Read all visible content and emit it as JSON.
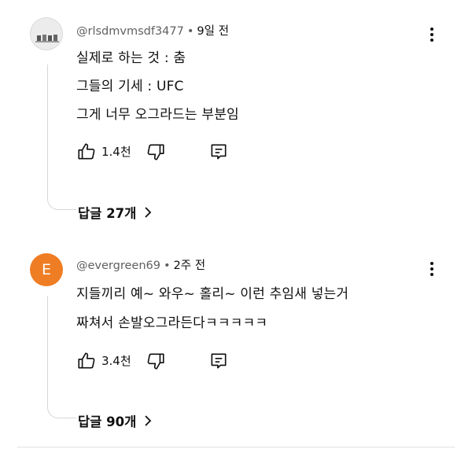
{
  "comments": [
    {
      "handle": "@rlsdmvmsdf3477",
      "time": "9일 전",
      "lines": [
        "실제로 하는 것 : 춤",
        "그들의 기세 : UFC",
        "그게 너무 오그라드는 부분임"
      ],
      "likes": "1.4천",
      "replies_label": "답글 27개",
      "avatar_type": "image"
    },
    {
      "handle": "@evergreen69",
      "time": "2주 전",
      "avatar_letter": "E",
      "lines": [
        "지들끼리 예~ 와우~ 홀리~ 이런 추임새 넣는거",
        "짜쳐서 손발오그라든다ㅋㅋㅋㅋㅋ"
      ],
      "likes": "3.4천",
      "replies_label": "답글 90개",
      "avatar_type": "letter",
      "avatar_color": "#ef7d24"
    }
  ],
  "separator_dot": "•",
  "icons": {
    "like": "thumb-up-icon",
    "dislike": "thumb-down-icon",
    "reply": "reply-comment-icon",
    "more": "more-vert-icon",
    "chevron": "chevron-right-icon"
  }
}
